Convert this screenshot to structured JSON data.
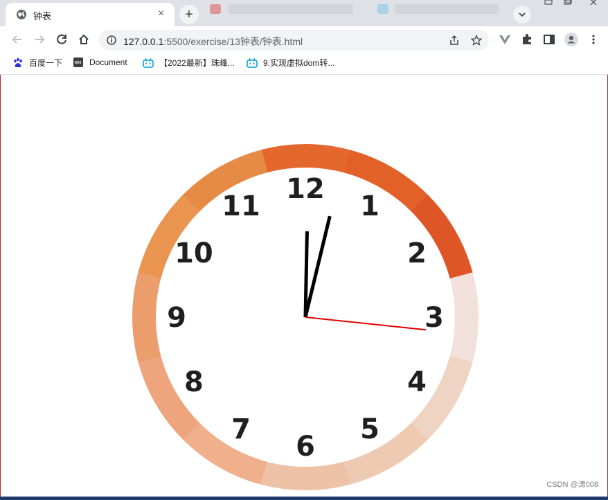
{
  "tab": {
    "title": "钟表",
    "close_glyph": "×",
    "new_tab_glyph": "+"
  },
  "toolbar": {
    "url_host": "127.0.0.1",
    "url_path": ":5500/exercise/13钟表/钟表.html"
  },
  "bookmarks": [
    {
      "label": "百度一下",
      "icon": "baidu-paw-icon",
      "color": "#2932e1"
    },
    {
      "label": "Document",
      "icon": "document-icon",
      "color": "#3c4043"
    },
    {
      "label": "【2022最新】珠峰...",
      "icon": "bilibili-icon",
      "color": "#00a1d6"
    },
    {
      "label": "9.实现虚拟dom转...",
      "icon": "bilibili-icon",
      "color": "#00a1d6"
    }
  ],
  "clock": {
    "numbers": [
      "12",
      "1",
      "2",
      "3",
      "4",
      "5",
      "6",
      "7",
      "8",
      "9",
      "10",
      "11"
    ],
    "time": {
      "hours": 12,
      "minutes": 2,
      "seconds": 16
    },
    "ring_colors": [
      "#e4682e",
      "#e26129",
      "#de5526",
      "#f2e0db",
      "#f0d4c3",
      "#efcab3",
      "#eec2a6",
      "#efb08b",
      "#eea57e",
      "#eb9d6c",
      "#e9954f",
      "#e68b45"
    ],
    "hand_color": "#000000",
    "second_hand_color": "#e10000"
  },
  "watermark": "CSDN @涛008"
}
